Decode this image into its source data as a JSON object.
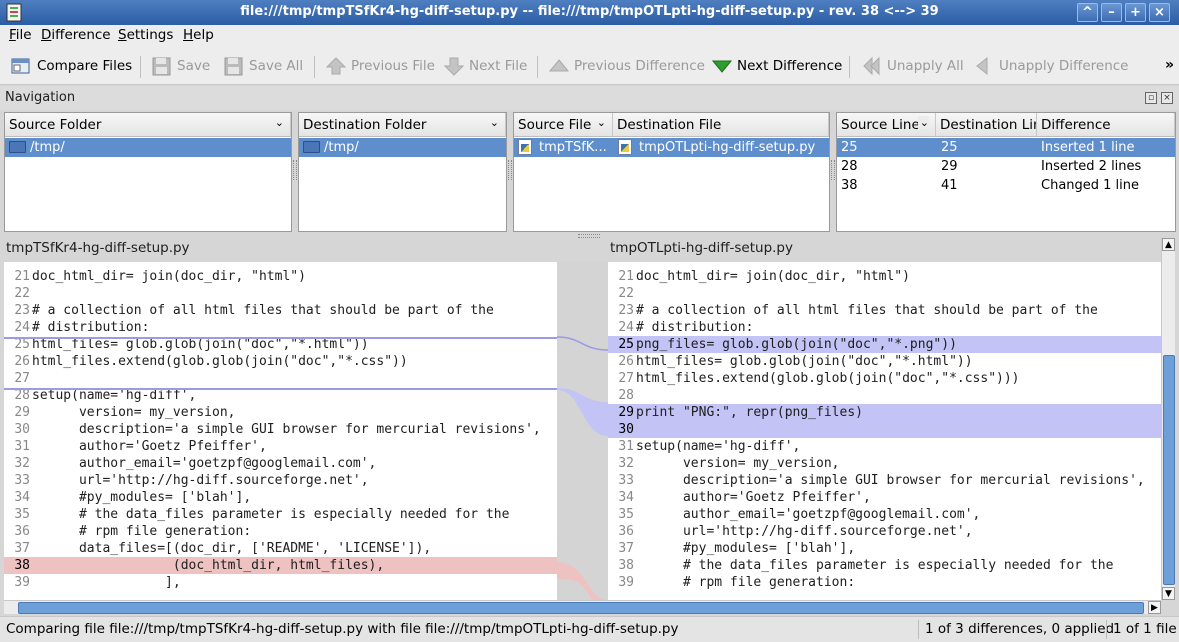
{
  "window": {
    "title": "file:///tmp/tmpTSfKr4-hg-diff-setup.py -- file:///tmp/tmpOTLpti-hg-diff-setup.py - rev. 38 <--> 39",
    "controls": [
      "^",
      "–",
      "+",
      "×"
    ]
  },
  "menu": [
    {
      "key": "F",
      "rest": "ile"
    },
    {
      "key": "D",
      "rest": "ifference"
    },
    {
      "key": "S",
      "rest": "ettings"
    },
    {
      "key": "H",
      "rest": "elp"
    }
  ],
  "toolbar": {
    "compare_files": "Compare Files",
    "save": "Save",
    "save_all": "Save All",
    "previous_file": "Previous File",
    "next_file": "Next File",
    "previous_difference": "Previous Difference",
    "next_difference": "Next Difference",
    "unapply_all": "Unapply All",
    "unapply_difference": "Unapply Difference",
    "more": "»"
  },
  "navigation": {
    "title": "Navigation",
    "source_folder": {
      "header": "Source Folder",
      "items": [
        "/tmp/"
      ]
    },
    "destination_folder": {
      "header": "Destination Folder",
      "items": [
        "/tmp/"
      ]
    },
    "files": {
      "header_source": "Source File",
      "header_destination": "Destination File",
      "rows": [
        {
          "source": "tmpTSfK...",
          "destination": "tmpOTLpti-hg-diff-setup.py"
        }
      ]
    },
    "differences": {
      "header_source_line": "Source Line",
      "header_destination_line": "Destination Line",
      "header_difference": "Difference",
      "rows": [
        {
          "src": "25",
          "dst": "25",
          "diff": "Inserted 1 line"
        },
        {
          "src": "28",
          "dst": "29",
          "diff": "Inserted 2 lines"
        },
        {
          "src": "38",
          "dst": "41",
          "diff": "Changed 1 line"
        }
      ]
    }
  },
  "left_file": {
    "name": "tmpTSfKr4-hg-diff-setup.py",
    "lines": [
      {
        "n": "21",
        "t": "doc_html_dir= join(doc_dir, \"html\")",
        "k": ""
      },
      {
        "n": "22",
        "t": "",
        "k": ""
      },
      {
        "n": "23",
        "t": "# a collection of all html files that should be part of the",
        "k": ""
      },
      {
        "n": "24",
        "t": "# distribution:",
        "k": ""
      },
      {
        "n": "25",
        "t": "html_files= glob.glob(join(\"doc\",\"*.html\"))",
        "k": ""
      },
      {
        "n": "26",
        "t": "html_files.extend(glob.glob(join(\"doc\",\"*.css\"))",
        "k": ""
      },
      {
        "n": "27",
        "t": "",
        "k": ""
      },
      {
        "n": "28",
        "t": "setup(name='hg-diff',",
        "k": ""
      },
      {
        "n": "29",
        "t": "      version= my_version,",
        "k": ""
      },
      {
        "n": "30",
        "t": "      description='a simple GUI browser for mercurial revisions',",
        "k": ""
      },
      {
        "n": "31",
        "t": "      author='Goetz Pfeiffer',",
        "k": ""
      },
      {
        "n": "32",
        "t": "      author_email='goetzpf@googlemail.com',",
        "k": ""
      },
      {
        "n": "33",
        "t": "      url='http://hg-diff.sourceforge.net',",
        "k": ""
      },
      {
        "n": "34",
        "t": "      #py_modules= ['blah'],",
        "k": ""
      },
      {
        "n": "35",
        "t": "      # the data_files parameter is especially needed for the",
        "k": ""
      },
      {
        "n": "36",
        "t": "      # rpm file generation:",
        "k": ""
      },
      {
        "n": "37",
        "t": "      data_files=[(doc_dir, ['README', 'LICENSE']),",
        "k": ""
      },
      {
        "n": "38",
        "t": "                  (doc_html_dir, html_files),",
        "k": "chg"
      },
      {
        "n": "39",
        "t": "                 ],",
        "k": ""
      }
    ]
  },
  "right_file": {
    "name": "tmpOTLpti-hg-diff-setup.py",
    "lines": [
      {
        "n": "21",
        "t": "doc_html_dir= join(doc_dir, \"html\")",
        "k": ""
      },
      {
        "n": "22",
        "t": "",
        "k": ""
      },
      {
        "n": "23",
        "t": "# a collection of all html files that should be part of the",
        "k": ""
      },
      {
        "n": "24",
        "t": "# distribution:",
        "k": ""
      },
      {
        "n": "25",
        "t": "png_files= glob.glob(join(\"doc\",\"*.png\"))",
        "k": "ins"
      },
      {
        "n": "26",
        "t": "html_files= glob.glob(join(\"doc\",\"*.html\"))",
        "k": ""
      },
      {
        "n": "27",
        "t": "html_files.extend(glob.glob(join(\"doc\",\"*.css\")))",
        "k": ""
      },
      {
        "n": "28",
        "t": "",
        "k": ""
      },
      {
        "n": "29",
        "t": "print \"PNG:\", repr(png_files)",
        "k": "ins"
      },
      {
        "n": "30",
        "t": "",
        "k": "ins"
      },
      {
        "n": "31",
        "t": "setup(name='hg-diff',",
        "k": ""
      },
      {
        "n": "32",
        "t": "      version= my_version,",
        "k": ""
      },
      {
        "n": "33",
        "t": "      description='a simple GUI browser for mercurial revisions',",
        "k": ""
      },
      {
        "n": "34",
        "t": "      author='Goetz Pfeiffer',",
        "k": ""
      },
      {
        "n": "35",
        "t": "      author_email='goetzpf@googlemail.com',",
        "k": ""
      },
      {
        "n": "36",
        "t": "      url='http://hg-diff.sourceforge.net',",
        "k": ""
      },
      {
        "n": "37",
        "t": "      #py_modules= ['blah'],",
        "k": ""
      },
      {
        "n": "38",
        "t": "      # the data_files parameter is especially needed for the",
        "k": ""
      },
      {
        "n": "39",
        "t": "      # rpm file generation:",
        "k": ""
      }
    ]
  },
  "status": {
    "message": "Comparing file file:///tmp/tmpTSfKr4-hg-diff-setup.py with file file:///tmp/tmpOTLpti-hg-diff-setup.py",
    "differences": "1 of 3 differences, 0 applied",
    "files": "1 of 1 file"
  },
  "colors": {
    "inserted": "#c3c3f6",
    "changed": "#efc2c2",
    "selection": "#5e8fcc"
  }
}
